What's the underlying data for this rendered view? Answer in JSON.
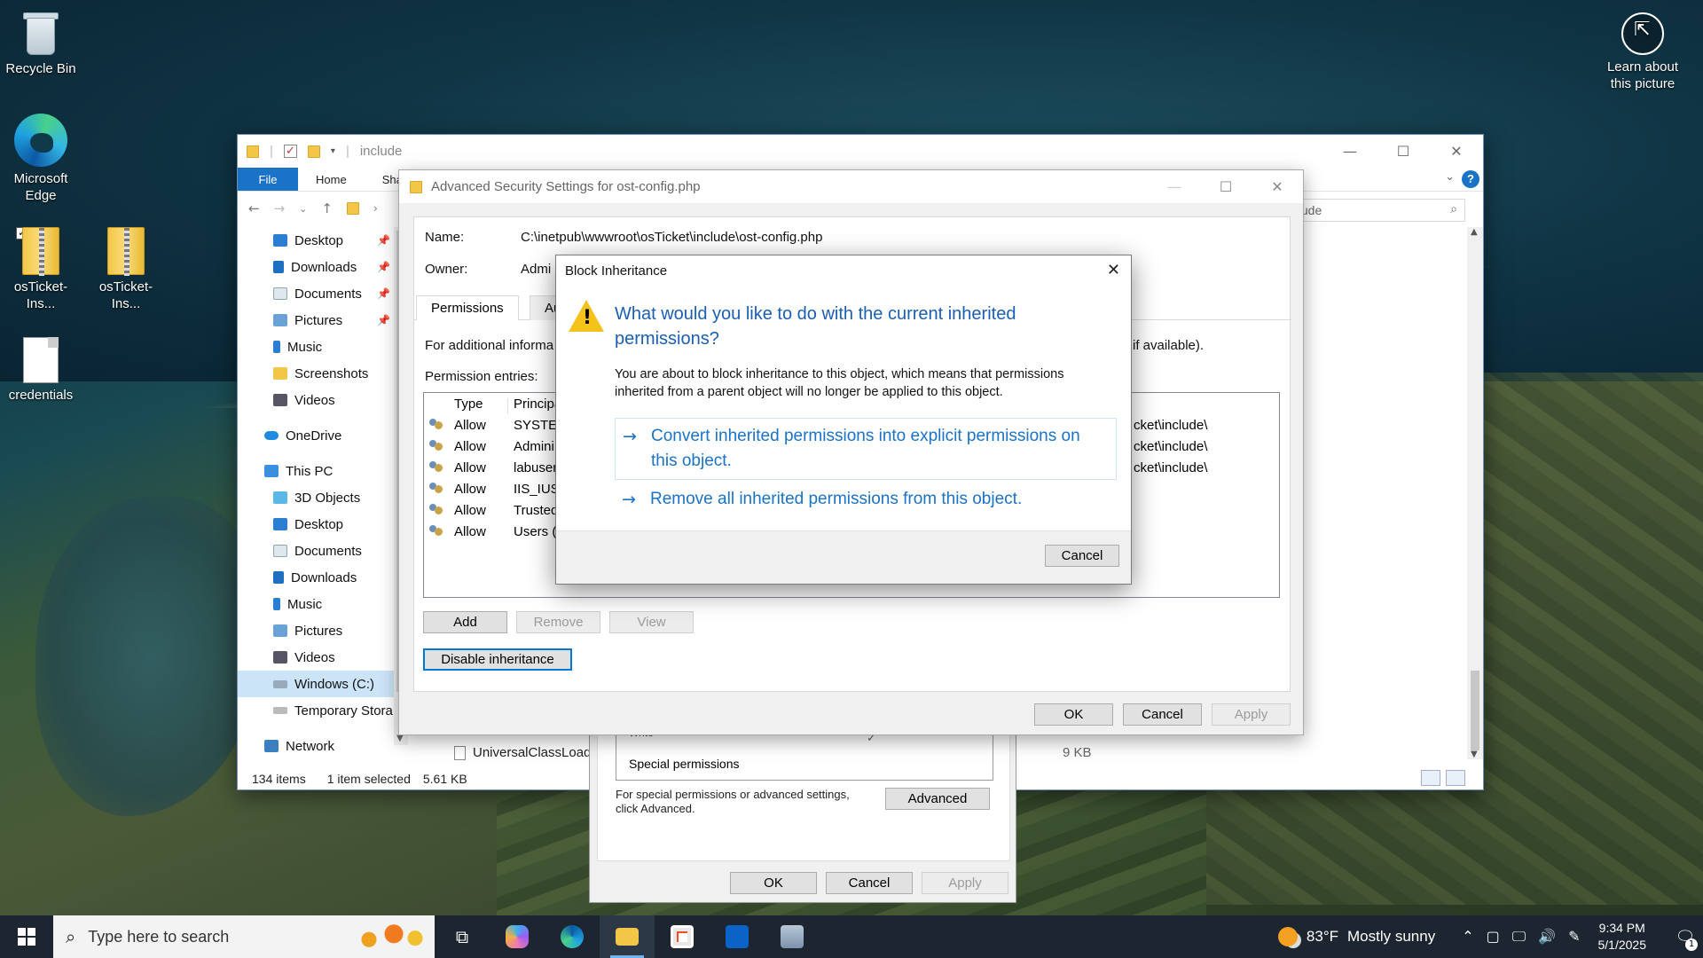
{
  "desktop": {
    "icons": [
      {
        "label": "Recycle Bin"
      },
      {
        "label": "Microsoft Edge"
      },
      {
        "label": "osTicket-Ins..."
      },
      {
        "label": "osTicket-Ins..."
      },
      {
        "label": "credentials"
      },
      {
        "label": "Learn about this picture"
      }
    ]
  },
  "explorer": {
    "title": "include",
    "ribbon": {
      "file": "File",
      "home": "Home",
      "share": "Shar"
    },
    "search_text": "nclude",
    "nav": [
      {
        "label": "Desktop",
        "pinned": true
      },
      {
        "label": "Downloads",
        "pinned": true
      },
      {
        "label": "Documents",
        "pinned": true
      },
      {
        "label": "Pictures",
        "pinned": true
      },
      {
        "label": "Music"
      },
      {
        "label": "Screenshots"
      },
      {
        "label": "Videos"
      },
      {
        "label": "OneDrive"
      },
      {
        "label": "This PC"
      },
      {
        "label": "3D Objects"
      },
      {
        "label": "Desktop"
      },
      {
        "label": "Documents"
      },
      {
        "label": "Downloads"
      },
      {
        "label": "Music"
      },
      {
        "label": "Pictures"
      },
      {
        "label": "Videos"
      },
      {
        "label": "Windows (C:)"
      },
      {
        "label": "Temporary Stora"
      },
      {
        "label": "Network"
      }
    ],
    "status": {
      "items": "134 items",
      "selected": "1 item selected",
      "size": "5.61 KB"
    },
    "visible_file": "UniversalClassLoade",
    "visible_file_size": "9 KB"
  },
  "properties": {
    "list_prev": "Write",
    "list_row": "Special permissions",
    "note": "For special permissions or advanced settings, click Advanced.",
    "advanced": "Advanced",
    "ok": "OK",
    "cancel": "Cancel",
    "apply": "Apply"
  },
  "advanced_security": {
    "title": "Advanced Security Settings for ost-config.php",
    "name_label": "Name:",
    "name_value": "C:\\inetpub\\wwwroot\\osTicket\\include\\ost-config.php",
    "owner_label": "Owner:",
    "owner_value": "Admi",
    "tabs": [
      "Permissions",
      "Au"
    ],
    "info_text": "For additional informa",
    "info_text_end": "if available).",
    "entries_label": "Permission entries:",
    "columns": {
      "type": "Type",
      "principal": "Principa"
    },
    "entries": [
      {
        "type": "Allow",
        "principal": "SYSTEM",
        "path": "cket\\include\\"
      },
      {
        "type": "Allow",
        "principal": "Admini",
        "path": "cket\\include\\"
      },
      {
        "type": "Allow",
        "principal": "labuser",
        "path": "cket\\include\\"
      },
      {
        "type": "Allow",
        "principal": "IIS_IUSF",
        "path": ""
      },
      {
        "type": "Allow",
        "principal": "Trusted",
        "path": ""
      },
      {
        "type": "Allow",
        "principal": "Users (c",
        "path": ""
      }
    ],
    "add": "Add",
    "remove": "Remove",
    "view": "View",
    "disable_inheritance": "Disable inheritance",
    "ok": "OK",
    "cancel": "Cancel",
    "apply": "Apply"
  },
  "block_inheritance": {
    "title": "Block Inheritance",
    "question": "What would you like to do with the current inherited permissions?",
    "description": "You are about to block inheritance to this object, which means that permissions inherited from a parent object will no longer be applied to this object.",
    "option1": "Convert inherited permissions into explicit permissions on this object.",
    "option2": "Remove all inherited permissions from this object.",
    "cancel": "Cancel"
  },
  "taskbar": {
    "search_placeholder": "Type here to search",
    "weather_temp": "83°F",
    "weather_desc": "Mostly sunny",
    "time": "9:34 PM",
    "date": "5/1/2025",
    "notification_count": "1"
  }
}
